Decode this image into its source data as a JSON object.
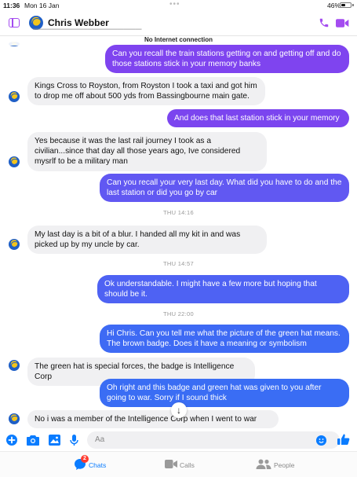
{
  "status_bar": {
    "time": "11:36",
    "date": "Mon 16 Jan",
    "battery": "46%",
    "battery_level": 0.46
  },
  "header": {
    "contact_name": "Chris Webber"
  },
  "banner": {
    "offline_text": "No Internet connection"
  },
  "colors": {
    "bubble_purple": "#7d45ef",
    "bubble_blue": "#3c6cf4",
    "accent": "#a44cf0",
    "link_blue": "#0a7cff"
  },
  "messages": [
    {
      "dir": "out",
      "text": "Can you recall the train stations getting on and getting off and do those stations stick in your memory banks"
    },
    {
      "dir": "in",
      "text": "Kings Cross to Royston, from Royston I took a taxi and got him to drop me off about 500 yds from Bassingbourne main gate."
    },
    {
      "dir": "out",
      "text": "And does that last station stick in your memory"
    },
    {
      "dir": "in",
      "text": "Yes because it was the last rail journey I took as a civilian...since that day all those years ago, Ive considered mysrlf to be a military man"
    },
    {
      "dir": "out",
      "text": "Can you recall your very last day. What did you have to do and the last station or did you go by car"
    },
    {
      "dir": "ts",
      "text": "THU 14:16"
    },
    {
      "dir": "in",
      "text": "My last day is a bit of a blur. I handed all my kit in and was picked up by my uncle by car."
    },
    {
      "dir": "ts",
      "text": "THU 14:57"
    },
    {
      "dir": "out",
      "text": "Ok understandable. I might have a few more but hoping that should be it."
    },
    {
      "dir": "ts",
      "text": "THU 22:00"
    },
    {
      "dir": "out",
      "text": "Hi Chris. Can you tell me what the picture of the green hat means. The brown badge. Does it have a meaning or symbolism"
    },
    {
      "dir": "in",
      "text": "The green hat is special forces, the badge is Intelligence Corp"
    },
    {
      "dir": "out",
      "text": "Oh right and this badge and green hat was given to you after going to war. Sorry if I sound thick"
    },
    {
      "dir": "in",
      "text": "No i was a member of the Intelligence Corp when I went to war"
    }
  ],
  "composer": {
    "placeholder": "Aa"
  },
  "tabs": [
    {
      "label": "Chats",
      "badge": "2",
      "active": true
    },
    {
      "label": "Calls",
      "active": false
    },
    {
      "label": "People",
      "active": false
    }
  ]
}
